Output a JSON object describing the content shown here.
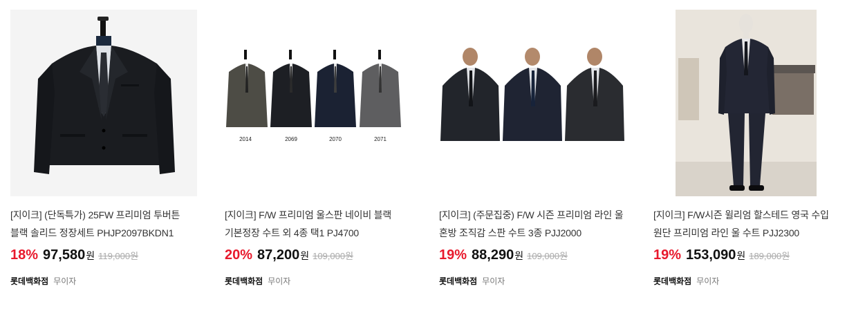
{
  "products": [
    {
      "title": "[지이크] (단독특가) 25FW 프리미엄 투버튼 블랙 솔리드 정장세트 PHJP2097BKDN1",
      "discount": "18%",
      "price": "97,580",
      "currency": "원",
      "original_price": "119,000원",
      "store": "롯데백화점",
      "shipping": "무이자"
    },
    {
      "title": "[지이크] F/W 프리미엄 울스판 네이비 블랙 기본정장 수트 외 4종 택1 PJ4700",
      "discount": "20%",
      "price": "87,200",
      "currency": "원",
      "original_price": "109,000원",
      "store": "롯데백화점",
      "shipping": "무이자",
      "image_labels": [
        "2014",
        "2069",
        "2070",
        "2071"
      ]
    },
    {
      "title": "[지이크] (주문집중) F/W 시즌 프리미엄 라인 울 혼방 조직감 스판 수트 3종 PJJ2000",
      "discount": "19%",
      "price": "88,290",
      "currency": "원",
      "original_price": "109,000원",
      "store": "롯데백화점",
      "shipping": "무이자"
    },
    {
      "title": "[지이크] F/W시즌 윌리엄 할스테드 영국 수입 원단 프리미엄 라인 울 수트 PJJ2300",
      "discount": "19%",
      "price": "153,090",
      "currency": "원",
      "original_price": "189,000원",
      "store": "롯데백화점",
      "shipping": "무이자"
    }
  ],
  "colors": {
    "discount": "#e8192c",
    "price": "#111111",
    "original_price": "#aaaaaa",
    "thumb_bg": "#f4f4f4"
  }
}
